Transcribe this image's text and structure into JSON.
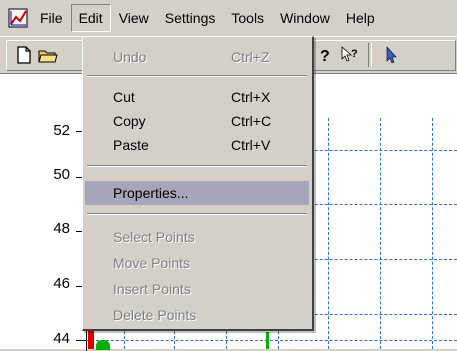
{
  "menubar": {
    "app_icon": "chart-app-icon",
    "items": [
      {
        "label": "File"
      },
      {
        "label": "Edit"
      },
      {
        "label": "View"
      },
      {
        "label": "Settings"
      },
      {
        "label": "Tools"
      },
      {
        "label": "Window"
      },
      {
        "label": "Help"
      }
    ],
    "active_item": "Edit"
  },
  "toolbar": {
    "icons": [
      "new-document-icon",
      "open-folder-icon",
      "help-icon",
      "context-help-icon",
      "pointer-icon"
    ]
  },
  "plot": {
    "y_ticks": [
      "52",
      "50",
      "48",
      "46",
      "44"
    ],
    "grid_color": "#2f6fd6"
  },
  "edit_menu": {
    "items": [
      {
        "label": "Undo",
        "shortcut": "Ctrl+Z",
        "enabled": false
      },
      {
        "label": "Cut",
        "shortcut": "Ctrl+X",
        "enabled": true
      },
      {
        "label": "Copy",
        "shortcut": "Ctrl+C",
        "enabled": true
      },
      {
        "label": "Paste",
        "shortcut": "Ctrl+V",
        "enabled": true
      },
      {
        "label": "Properties...",
        "shortcut": "",
        "enabled": true,
        "highlighted": true
      },
      {
        "label": "Select Points",
        "shortcut": "",
        "enabled": false
      },
      {
        "label": "Move Points",
        "shortcut": "",
        "enabled": false
      },
      {
        "label": "Insert Points",
        "shortcut": "",
        "enabled": false
      },
      {
        "label": "Delete Points",
        "shortcut": "",
        "enabled": false
      }
    ],
    "highlight_color": "#a6a6bb"
  }
}
